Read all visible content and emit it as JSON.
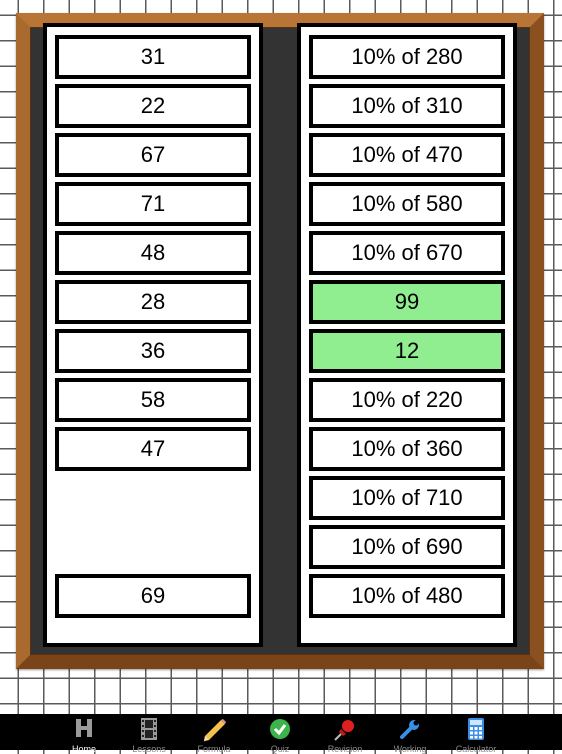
{
  "left_column": [
    "31",
    "22",
    "67",
    "71",
    "48",
    "28",
    "36",
    "58",
    "47",
    "",
    "",
    "69"
  ],
  "right_column": [
    {
      "text": "10% of 280",
      "matched": false
    },
    {
      "text": "10% of 310",
      "matched": false
    },
    {
      "text": "10% of 470",
      "matched": false
    },
    {
      "text": "10% of 580",
      "matched": false
    },
    {
      "text": "10% of 670",
      "matched": false
    },
    {
      "text": "99",
      "matched": true
    },
    {
      "text": "12",
      "matched": true
    },
    {
      "text": "10% of 220",
      "matched": false
    },
    {
      "text": "10% of 360",
      "matched": false
    },
    {
      "text": "10% of 710",
      "matched": false
    },
    {
      "text": "10% of 690",
      "matched": false
    },
    {
      "text": "10% of 480",
      "matched": false
    }
  ],
  "colors": {
    "matched": "#90ee90",
    "board": "#333333",
    "frame": "#a0622a"
  },
  "tabs": [
    {
      "label": "Home",
      "icon": "home-icon",
      "active": true
    },
    {
      "label": "Lessons",
      "icon": "film-icon",
      "active": false
    },
    {
      "label": "Formula",
      "icon": "pencil-icon",
      "active": false
    },
    {
      "label": "Quiz",
      "icon": "checkmark-icon",
      "active": false
    },
    {
      "label": "Revision",
      "icon": "pushpin-icon",
      "active": false
    },
    {
      "label": "Working",
      "icon": "wrench-icon",
      "active": false
    },
    {
      "label": "Calculator",
      "icon": "calculator-icon",
      "active": false
    }
  ]
}
